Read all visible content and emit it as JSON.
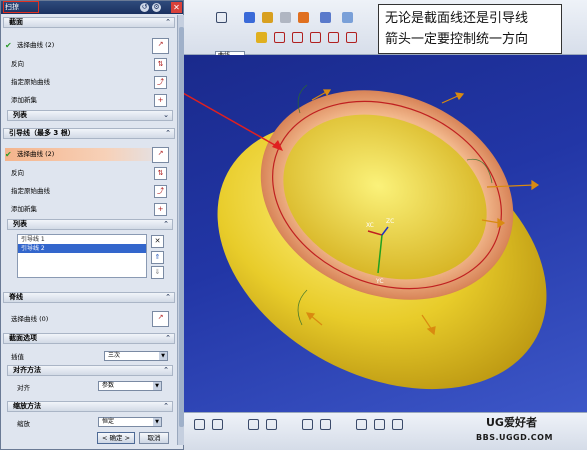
{
  "dialog": {
    "title": "扫掠",
    "section_section": {
      "title": "截面"
    },
    "select_curve_1": "选择曲线 (2)",
    "reverse_1": "反向",
    "specify_origin_1": "指定原始曲线",
    "add_new_set_1": "添加新集",
    "list_1": "列表",
    "guide_section": {
      "title": "引导线（最多 3 根）"
    },
    "select_curve_2": "选择曲线 (2)",
    "reverse_2": "反向",
    "specify_origin_2": "指定原始曲线",
    "add_new_set_2": "添加新集",
    "list_2": "列表",
    "guide_list": [
      "引导线 1",
      "引导线 2"
    ],
    "spine_section": {
      "title": "脊线"
    },
    "select_curve_3": "选择曲线 (0)",
    "section_options": {
      "title": "截面选项"
    },
    "interpolation_label": "插值",
    "interpolation_value": "三次",
    "alignment_section": "对齐方法",
    "alignment_label": "对齐",
    "alignment_value": "参数",
    "scaling_section": "缩放方法",
    "scaling_label": "缩放",
    "scaling_value": "恒定",
    "ok": "< 确定 >",
    "cancel": "取消"
  },
  "toolbar": {
    "filter_value": "曲线"
  },
  "callout": {
    "line1": "无论是截面线还是引导线",
    "line2": "箭头一定要控制统一方向"
  },
  "axes": {
    "x": "XC",
    "y": "YC",
    "z": "ZC"
  },
  "watermark": {
    "logo": "UG爱好者",
    "url": "BBS.UGGD.COM"
  },
  "colors": {
    "background": "#2a3fae",
    "body": "#e8cc2a",
    "ring": "#d9865a",
    "highlight": "#f4b48c"
  }
}
